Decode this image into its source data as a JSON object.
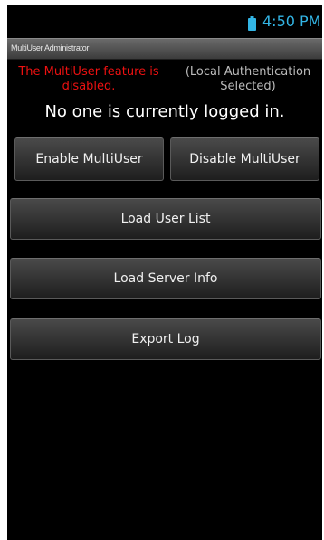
{
  "status_bar": {
    "time": "4:50 PM",
    "battery_icon": "battery-icon",
    "accent_color": "#33b5e5"
  },
  "app": {
    "title": "MultiUser Administrator"
  },
  "status": {
    "feature_message": "The MultiUser feature is disabled.",
    "feature_message_color": "#ee1111",
    "auth_message": "(Local Authentication Selected)",
    "logged_in_message": "No one is currently logged in."
  },
  "buttons": {
    "enable": "Enable MultiUser",
    "disable": "Disable MultiUser",
    "load_user_list": "Load User List",
    "load_server_info": "Load Server Info",
    "export_log": "Export Log"
  }
}
